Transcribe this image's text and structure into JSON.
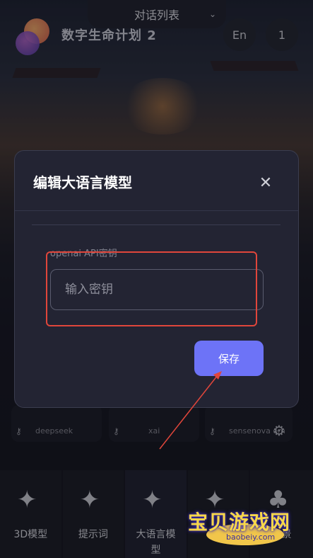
{
  "header": {
    "dropdown_title": "对话列表",
    "app_title": "数字生命计划 2",
    "language_button": "En",
    "count_button": "1"
  },
  "modal": {
    "title": "编辑大语言模型",
    "field_label": "openai API密钥",
    "input_placeholder": "输入密钥",
    "input_value": "",
    "save_label": "保存"
  },
  "model_cards": [
    {
      "label": "deepseek"
    },
    {
      "label": "xai"
    },
    {
      "label": "sensenova om"
    }
  ],
  "bottom_nav": [
    {
      "label": "3D模型"
    },
    {
      "label": "提示词"
    },
    {
      "label": "大语言模型"
    },
    {
      "label": ""
    },
    {
      "label": "场景"
    }
  ],
  "watermark": {
    "text": "宝贝游戏网",
    "url": "baobeiy.com"
  },
  "colors": {
    "accent": "#6d73f7",
    "highlight": "#e0463b",
    "modal_bg": "#232433"
  }
}
